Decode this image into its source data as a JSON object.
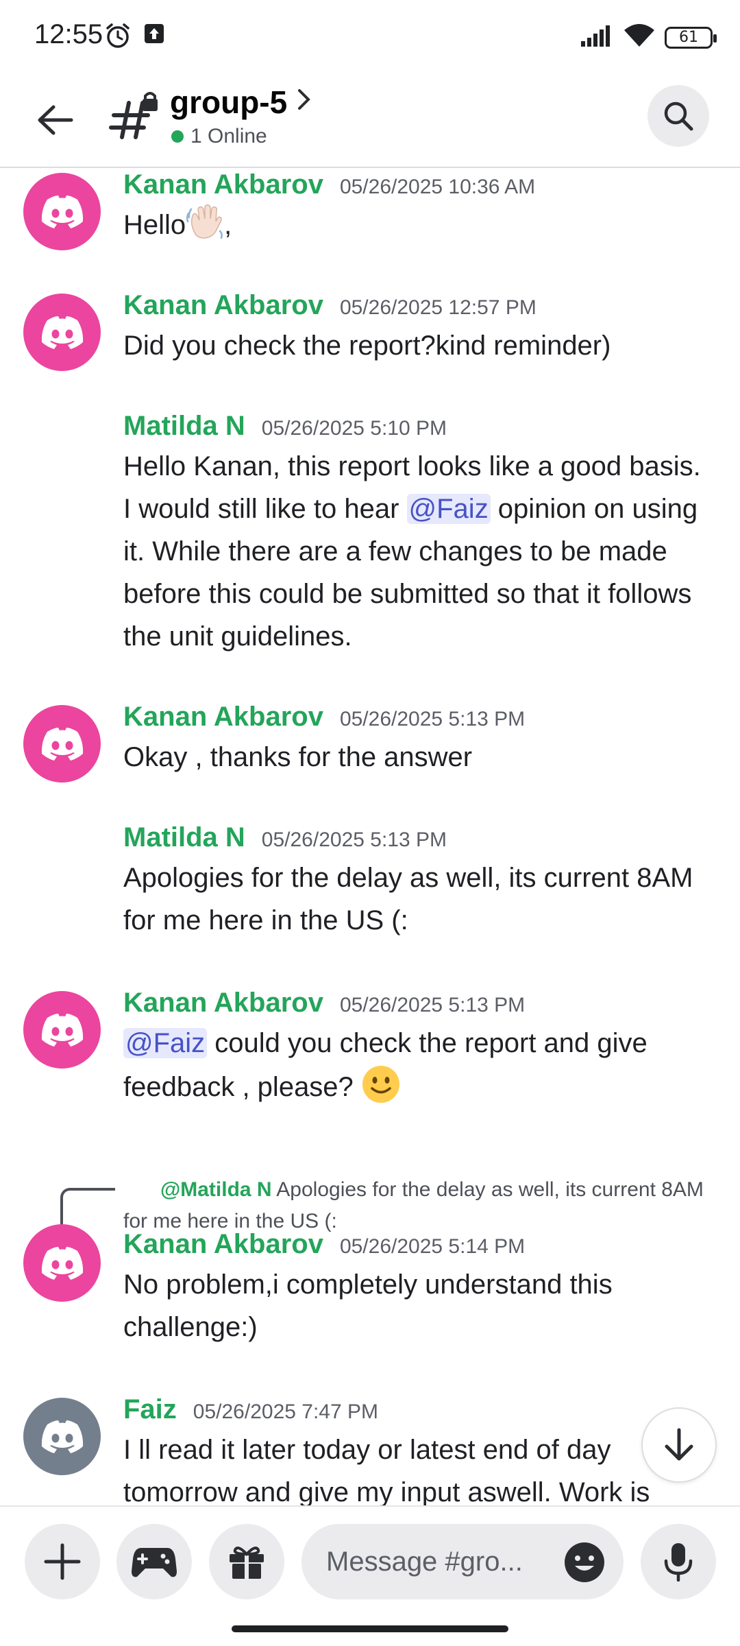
{
  "status_bar": {
    "time": "12:55",
    "battery": "61"
  },
  "header": {
    "channel_name": "group-5",
    "online_status": "1 Online"
  },
  "messages": [
    {
      "author": "Kanan Akbarov",
      "timestamp": "05/26/2025 10:36 AM",
      "text": "Hello",
      "suffix": ",",
      "avatar": "discord-pink"
    },
    {
      "author": "Kanan Akbarov",
      "timestamp": "05/26/2025 12:57 PM",
      "text": "Did you check the report?kind reminder)",
      "avatar": "discord-pink"
    },
    {
      "author": "Matilda N",
      "timestamp": "05/26/2025 5:10 PM",
      "text_before": "Hello Kanan, this report looks like a good basis. I would still like to hear ",
      "mention": "@Faiz",
      "text_after": " opinion on using it. While there are a few changes to be made before this could be submitted so that it follows the unit guidelines."
    },
    {
      "author": "Kanan Akbarov",
      "timestamp": "05/26/2025 5:13 PM",
      "text": "Okay , thanks for the answer",
      "avatar": "discord-pink"
    },
    {
      "author": "Matilda N",
      "timestamp": "05/26/2025 5:13 PM",
      "text": "Apologies for the delay as well, its current 8AM for me here in the US (:"
    },
    {
      "author": "Kanan Akbarov",
      "timestamp": "05/26/2025 5:13 PM",
      "mention": "@Faiz",
      "text_after": " could you check the report and give feedback , please?",
      "avatar": "discord-pink"
    },
    {
      "reply_mention": "@Matilda N",
      "reply_text": "Apologies for the delay as well, its current 8AM for me here in the US (:",
      "author": "Kanan Akbarov",
      "timestamp": "05/26/2025 5:14 PM",
      "text": "No problem,i completely understand this challenge:)",
      "avatar": "discord-pink"
    },
    {
      "author": "Faiz",
      "timestamp": "05/26/2025 7:47 PM",
      "text": "I ll read it later today or latest end of day tomorrow and give my input aswell. Work is",
      "avatar": "discord-gray"
    }
  ],
  "composer": {
    "placeholder": "Message #gro..."
  },
  "colors": {
    "author_green": "#23a55a",
    "avatar_pink": "#eb459f",
    "avatar_gray": "#747f8d",
    "mention_bg": "#e6e8fd",
    "mention_fg": "#4752c4"
  }
}
